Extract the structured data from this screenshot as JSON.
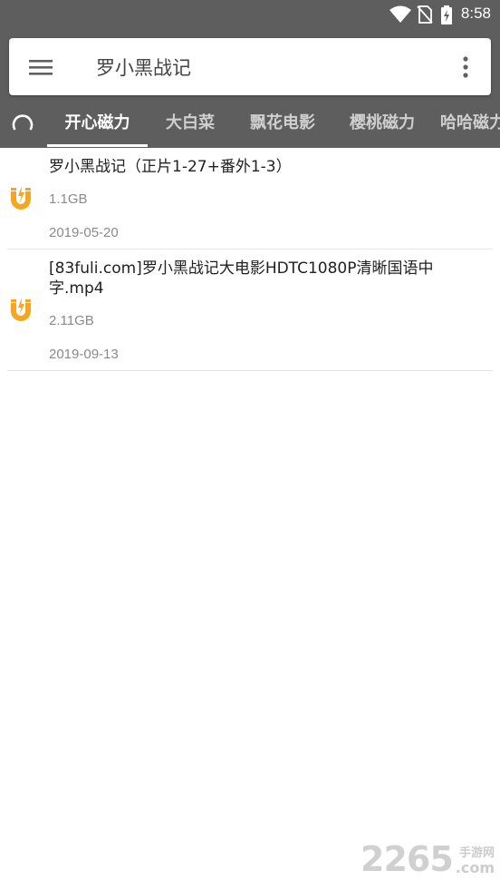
{
  "status_bar": {
    "time": "8:58",
    "icons": [
      "wifi-icon",
      "no-sim-icon",
      "battery-charging-icon"
    ]
  },
  "search_bar": {
    "query": "罗小黑战记",
    "menu_icon": "menu-icon",
    "more_icon": "more-vert-icon"
  },
  "tabs": {
    "refresh_icon": "refresh-icon",
    "items": [
      {
        "label": "开心磁力",
        "active": true
      },
      {
        "label": "大白菜",
        "active": false
      },
      {
        "label": "飘花电影",
        "active": false
      },
      {
        "label": "樱桃磁力",
        "active": false
      },
      {
        "label": "哈哈磁力",
        "active": false
      }
    ]
  },
  "results": [
    {
      "icon": "magnet-icon",
      "title": "罗小黑战记（正片1-27+番外1-3）",
      "size": "1.1GB",
      "date": "2019-05-20"
    },
    {
      "icon": "magnet-icon",
      "title": "[83fuli.com]罗小黑战记大电影HDTC1080P清晰国语中字.mp4",
      "size": "2.11GB",
      "date": "2019-09-13"
    }
  ],
  "watermark": {
    "number": "2265",
    "site_cn": "手游网",
    "site_domain": ".com"
  },
  "colors": {
    "header": "#5e5e5e",
    "magnet_orange": "#f5a623",
    "active_tab": "#ffffff",
    "inactive_tab": "#cfcfcf"
  }
}
